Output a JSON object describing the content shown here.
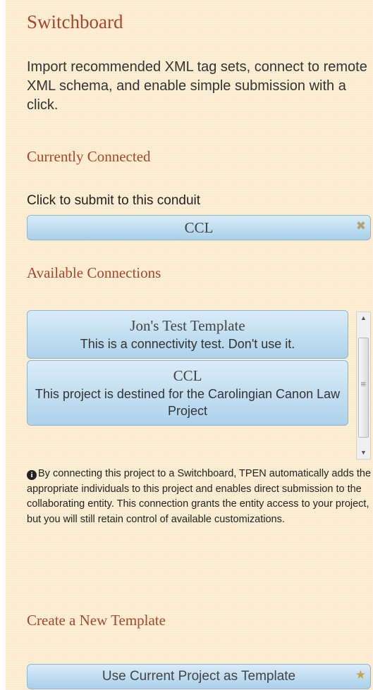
{
  "panel": {
    "title": "Switchboard",
    "intro": "Import recommended XML tag sets, connect to remote XML schema, and enable simple submission with a click."
  },
  "connected": {
    "heading": "Currently Connected",
    "cta_label": "Click to submit to this conduit",
    "item_label": "CCL",
    "remove_icon": "x-icon"
  },
  "available": {
    "heading": "Available Connections",
    "items": [
      {
        "name": "Jon's Test Template",
        "description": "This is a connectivity test. Don't use it."
      },
      {
        "name": "CCL",
        "description": "This project is destined for the Carolingian Canon Law Project"
      }
    ]
  },
  "notice": {
    "icon": "info-icon",
    "text": "By connecting this project to a Switchboard, TPEN automatically adds the appropriate individuals to this project and enables direct submission to the collaborating entity. This connection grants the entity access to your project, but you will still retain control of available customizations."
  },
  "create": {
    "heading": "Create a New Template",
    "button_label": "Use Current Project as Template",
    "star_icon": "star-icon"
  },
  "colors": {
    "background": "#fbeacb",
    "heading": "#a8462c",
    "pill_top": "#d9ecf8",
    "pill_bottom": "#a9d0ea",
    "pill_border": "#8fb6cf"
  }
}
